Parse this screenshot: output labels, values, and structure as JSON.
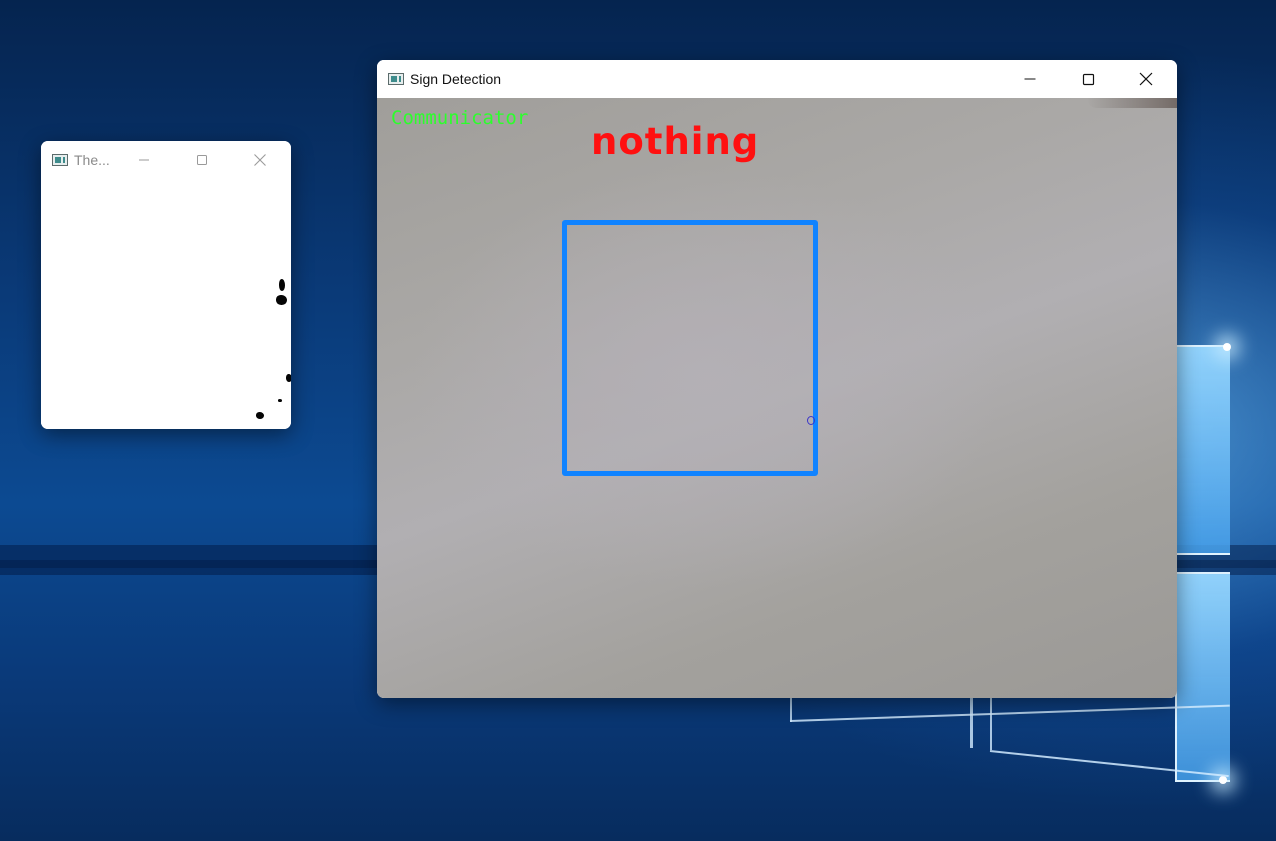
{
  "threshold_window": {
    "title": "The...",
    "icon": "app-window-icon",
    "controls": {
      "minimize_icon": "minimize-icon",
      "maximize_icon": "maximize-icon",
      "close_icon": "close-icon"
    }
  },
  "main_window": {
    "title": "Sign Detection",
    "icon": "app-window-icon",
    "controls": {
      "minimize_icon": "minimize-icon",
      "maximize_icon": "maximize-icon",
      "close_icon": "close-icon"
    },
    "overlay": {
      "app_label": "Communicator",
      "prediction": "nothing"
    }
  },
  "colors": {
    "app_label": "#2cff2c",
    "prediction": "#ff1010",
    "roi_box": "#1083ff"
  }
}
